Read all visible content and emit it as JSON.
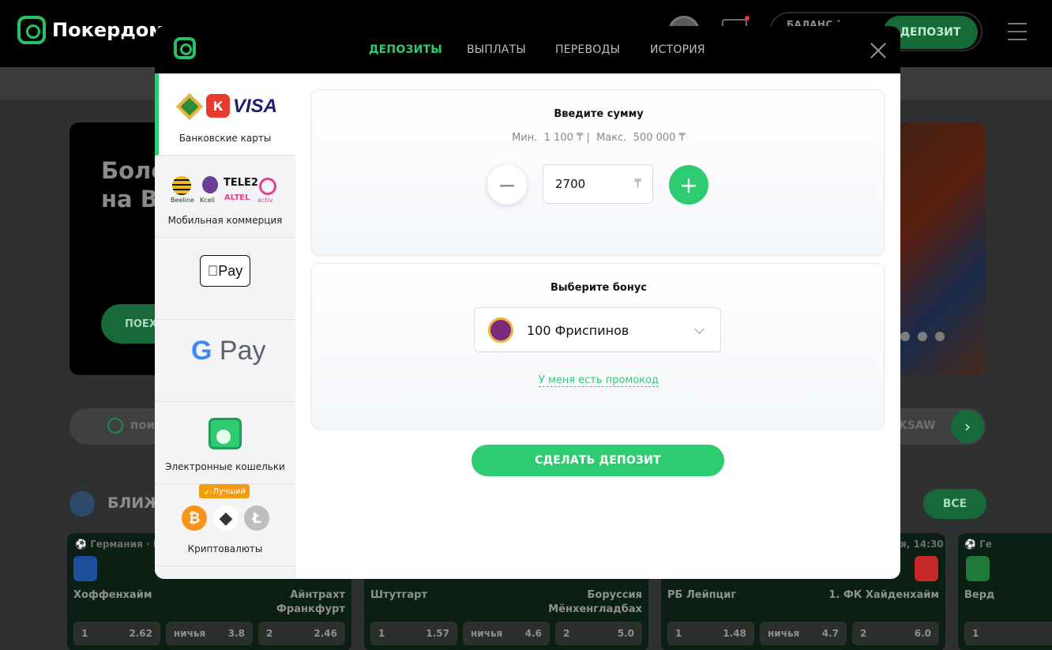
{
  "background": {
    "logo_text": "Покердом",
    "balance_label": "БАЛАНС",
    "deposit_button": "ДЕПОЗИТ",
    "banner_title_line1": "Боле",
    "banner_title_line2": "на Ви",
    "banner_button": "ПОЕХ",
    "search_placeholder": "пои",
    "search_right_text": "KSAW",
    "section_title": "БЛИЖ",
    "all_button": "ВСЕ",
    "matches": [
      {
        "league": "Германия · Бу",
        "home": "Хоффенхайм",
        "away": "Айнтрахт Франкфурт",
        "odd1": "2.62",
        "oddx": "3.8",
        "odd2": "2.46"
      },
      {
        "league": "",
        "home": "Штутгарт",
        "away_line1": "Боруссия",
        "away_line2": "Мёнхенгладбах",
        "odd1": "1.57",
        "oddx": "4.6",
        "odd2": "5.0"
      },
      {
        "league": "я, 14:30",
        "home": "РБ Лейпциг",
        "away": "1. ФК Хайденхайм",
        "odd1": "1.48",
        "oddx": "4.7",
        "odd2": "6.0"
      },
      {
        "league": "Ге",
        "home": "Верд",
        "odd1": "1"
      }
    ],
    "odd_labels": {
      "home": "1",
      "draw": "ничья",
      "away": "2"
    }
  },
  "modal": {
    "tabs": [
      {
        "label": "ДЕПОЗИТЫ",
        "active": true
      },
      {
        "label": "ВЫПЛАТЫ",
        "active": false
      },
      {
        "label": "ПЕРЕВОДЫ",
        "active": false
      },
      {
        "label": "ИСТОРИЯ",
        "active": false
      }
    ],
    "methods": [
      {
        "label": "Банковские карты",
        "active": true,
        "logos": [
          "halyk-icon",
          "kaspi-icon",
          "VISA"
        ]
      },
      {
        "label": "Мобильная коммерция",
        "logos": [
          "Beeline",
          "Kcell",
          "TELE2",
          "ALTEL",
          "activ"
        ]
      },
      {
        "label": "",
        "logos": [
          "Pay"
        ]
      },
      {
        "label": "",
        "logos": [
          "G",
          "Pay"
        ]
      },
      {
        "label": "Электронные кошельки",
        "logos": [
          "wallet-icon"
        ]
      },
      {
        "label": "Криптовалюты",
        "badge": "Лучший",
        "logos": [
          "bitcoin-icon",
          "ethereum-icon",
          "litecoin-icon"
        ]
      }
    ],
    "amount_card": {
      "title": "Введите сумму",
      "min_label": "Мин.",
      "min_value": "1 100 ₸",
      "max_label": "Макс.",
      "max_value": "500 000 ₸",
      "amount": "2700",
      "currency": "₸",
      "minus": "−",
      "plus": "+"
    },
    "bonus_card": {
      "title": "Выберите бонус",
      "selected": "100 Фриспинов",
      "promo_link": "У меня есть промокод"
    },
    "submit_label": "СДЕЛАТЬ ДЕПОЗИТ"
  },
  "colors": {
    "accent": "#2ecc71",
    "header_bg": "#000000",
    "overlay": "#2f3031"
  }
}
